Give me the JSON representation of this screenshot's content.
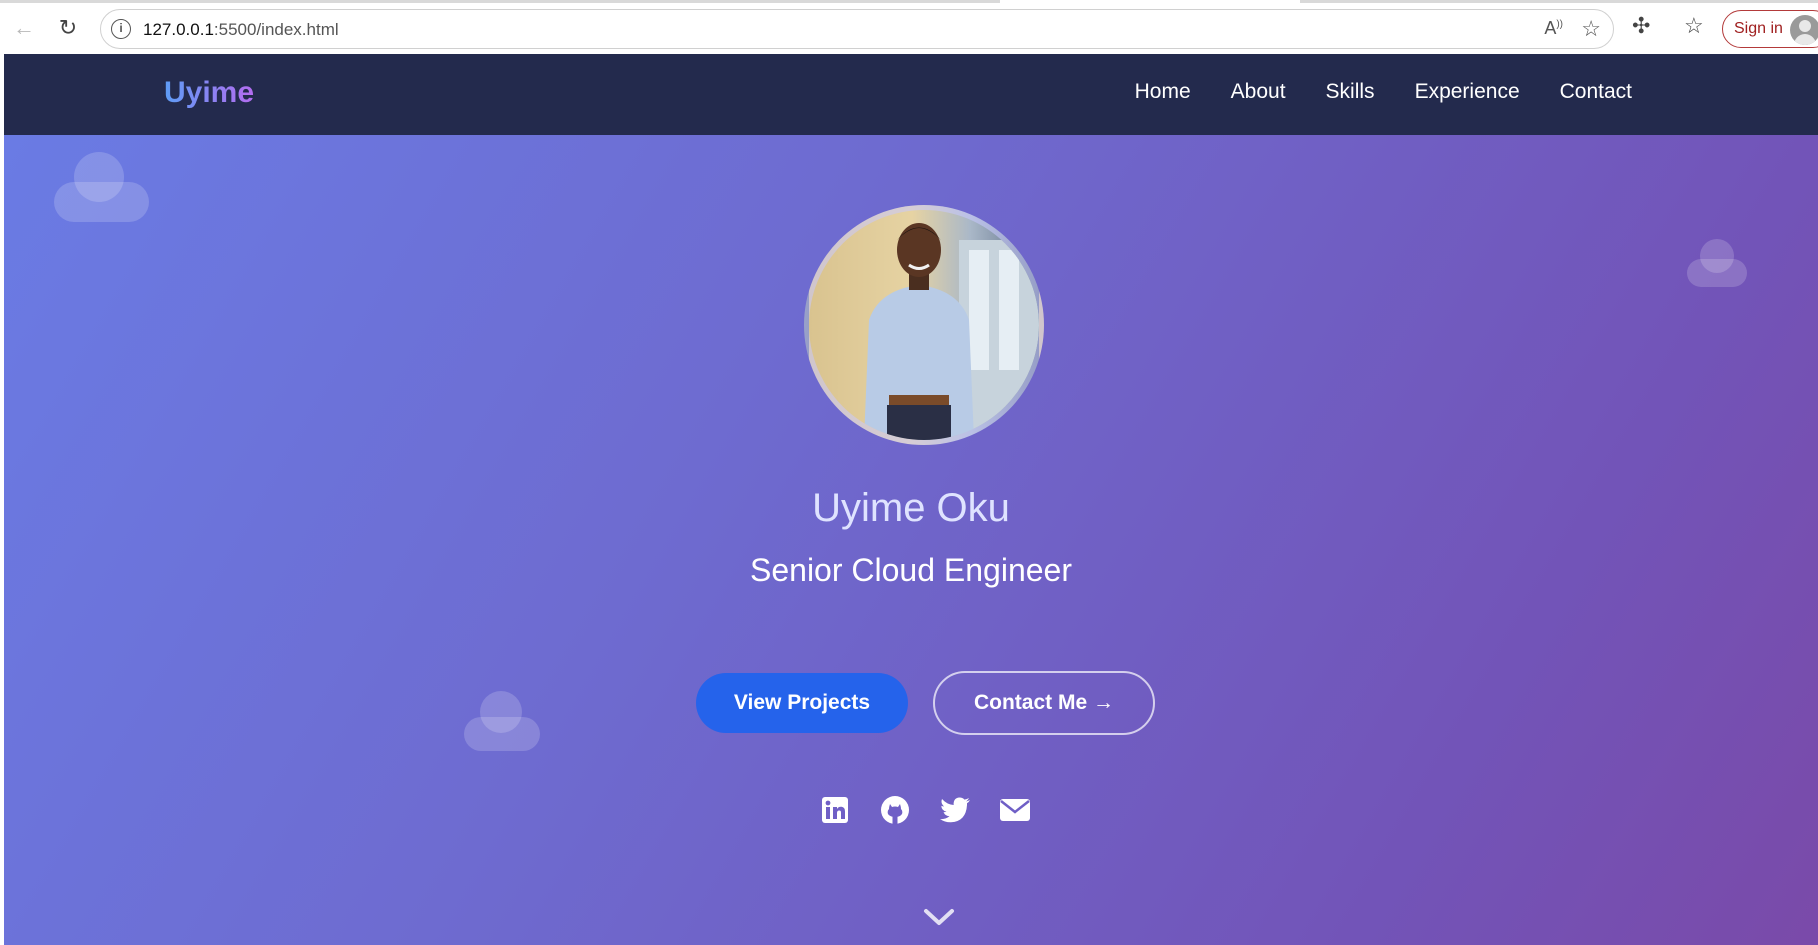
{
  "browser": {
    "url_host": "127.0.0.1",
    "url_path": ":5500/index.html",
    "read_aloud_glyph": "A",
    "signin_label": "Sign in"
  },
  "nav": {
    "brand": "Uyime",
    "links": [
      "Home",
      "About",
      "Skills",
      "Experience",
      "Contact"
    ]
  },
  "hero": {
    "name": "Uyime Oku",
    "title": "Senior Cloud Engineer",
    "primary_button": "View Projects",
    "secondary_button": "Contact Me →",
    "socials": [
      "linkedin-icon",
      "github-icon",
      "twitter-icon",
      "email-icon"
    ]
  },
  "colors": {
    "navbar": "#232a4d",
    "primary_button": "#2563eb",
    "hero_gradient_start": "#6a7ce5",
    "hero_gradient_end": "#7a4aa9"
  }
}
